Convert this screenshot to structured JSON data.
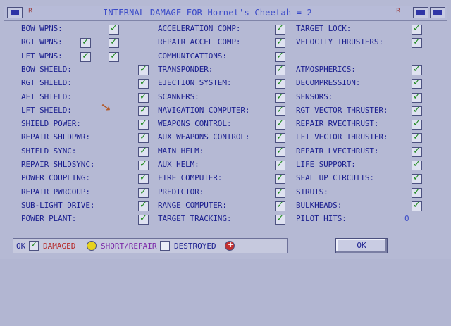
{
  "window": {
    "title": "INTERNAL DAMAGE FOR Hornet's Cheetah = 2"
  },
  "colors": {
    "ok": "#1f8a1f",
    "damaged": "#d8c21a",
    "short_repair": "#e9edf7",
    "destroyed": "#c23030"
  },
  "col1": [
    {
      "label": "BOW WPNS:",
      "checks": 1
    },
    {
      "label": "RGT WPNS:",
      "checks": 2
    },
    {
      "label": "LFT WPNS:",
      "checks": 2
    },
    {
      "label": "BOW SHIELD:",
      "checks": 1
    },
    {
      "label": "RGT SHIELD:",
      "checks": 1
    },
    {
      "label": "AFT SHIELD:",
      "checks": 1
    },
    {
      "label": "LFT SHIELD:",
      "checks": 1
    },
    {
      "label": "SHIELD POWER:",
      "checks": 1
    },
    {
      "label": "REPAIR SHLDPWR:",
      "checks": 1
    },
    {
      "label": "SHIELD SYNC:",
      "checks": 1
    },
    {
      "label": "REPAIR SHLDSYNC:",
      "checks": 1
    },
    {
      "label": "POWER COUPLING:",
      "checks": 1
    },
    {
      "label": "REPAIR PWRCOUP:",
      "checks": 1
    },
    {
      "label": "SUB-LIGHT DRIVE:",
      "checks": 1
    },
    {
      "label": "POWER PLANT:",
      "checks": 1
    }
  ],
  "col2": [
    {
      "label": "ACCELERATION COMP:",
      "checks": 1
    },
    {
      "label": "REPAIR ACCEL COMP:",
      "checks": 1
    },
    {
      "label": "COMMUNICATIONS:",
      "checks": 1
    },
    {
      "label": "TRANSPONDER:",
      "checks": 1
    },
    {
      "label": "EJECTION SYSTEM:",
      "checks": 1
    },
    {
      "label": "SCANNERS:",
      "checks": 1
    },
    {
      "label": "NAVIGATION COMPUTER:",
      "checks": 1
    },
    {
      "label": "WEAPONS CONTROL:",
      "checks": 1
    },
    {
      "label": "AUX WEAPONS CONTROL:",
      "checks": 1
    },
    {
      "label": "MAIN HELM:",
      "checks": 1
    },
    {
      "label": "AUX HELM:",
      "checks": 1
    },
    {
      "label": "FIRE COMPUTER:",
      "checks": 1
    },
    {
      "label": "PREDICTOR:",
      "checks": 1
    },
    {
      "label": "RANGE COMPUTER:",
      "checks": 1
    },
    {
      "label": "TARGET TRACKING:",
      "checks": 1
    }
  ],
  "col3": [
    {
      "label": "TARGET LOCK:",
      "checks": 1
    },
    {
      "label": "VELOCITY THRUSTERS:",
      "checks": 1
    },
    {
      "label": "",
      "checks": 0
    },
    {
      "label": "ATMOSPHERICS:",
      "checks": 1
    },
    {
      "label": "DECOMPRESSION:",
      "checks": 1
    },
    {
      "label": "SENSORS:",
      "checks": 1
    },
    {
      "label": "RGT VECTOR THRUSTER:",
      "checks": 1
    },
    {
      "label": "REPAIR RVECTHRUST:",
      "checks": 1
    },
    {
      "label": "LFT VECTOR THRUSTER:",
      "checks": 1
    },
    {
      "label": "REPAIR LVECTHRUST:",
      "checks": 1
    },
    {
      "label": "LIFE SUPPORT:",
      "checks": 1
    },
    {
      "label": "SEAL UP CIRCUITS:",
      "checks": 1
    },
    {
      "label": "STRUTS:",
      "checks": 1
    },
    {
      "label": "BULKHEADS:",
      "checks": 1
    },
    {
      "label": "PILOT HITS:",
      "value": "0"
    }
  ],
  "legend": {
    "ok": "OK",
    "damaged": "DAMAGED",
    "short_repair": "SHORT/REPAIR",
    "destroyed": "DESTROYED"
  },
  "ok_button": "OK",
  "check_glyph": "✓"
}
